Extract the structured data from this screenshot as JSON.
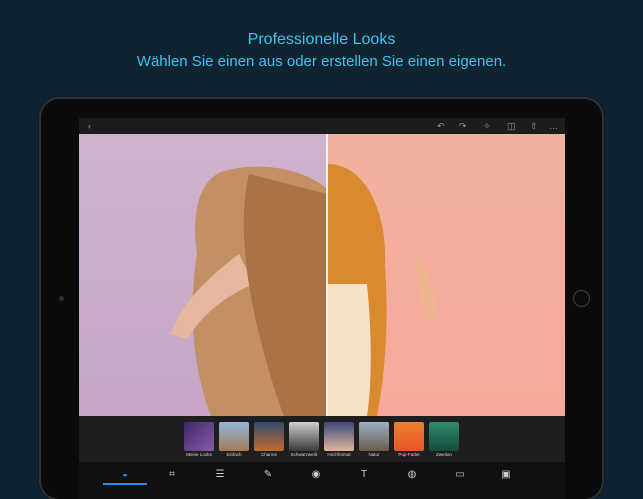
{
  "header": {
    "title": "Professionelle Looks",
    "subtitle": "Wählen Sie einen aus oder erstellen Sie einen eigenen."
  },
  "topbar": {
    "back_icon": "chevron-left-icon",
    "undo_icon": "undo-icon",
    "redo_icon": "redo-icon",
    "auto_fix_icon": "magic-wand-icon",
    "compare_icon": "compare-icon",
    "share_icon": "share-icon",
    "more_icon": "more-icon"
  },
  "looks": [
    {
      "label": "Meine Looks",
      "color": "#5b3b7a"
    },
    {
      "label": "Einfach",
      "color": "#7aa3c9"
    },
    {
      "label": "Charme",
      "color": "#c36a2e"
    },
    {
      "label": "Schwarzweiß",
      "color": "#8a8a8a"
    },
    {
      "label": "Hochformat",
      "color": "#c8a090"
    },
    {
      "label": "Natur",
      "color": "#7c8fa0"
    },
    {
      "label": "Pop-Farbe",
      "color": "#f07f2b"
    },
    {
      "label": "Zweiton",
      "color": "#2f8c6e"
    }
  ],
  "tools": [
    {
      "name": "looks-tool",
      "icon": "looks-icon",
      "glyph": "◒",
      "active": true
    },
    {
      "name": "crop-tool",
      "icon": "crop-icon",
      "glyph": "⌗"
    },
    {
      "name": "adjust-tool",
      "icon": "sliders-icon",
      "glyph": "☰"
    },
    {
      "name": "heal-tool",
      "icon": "bandage-icon",
      "glyph": "✎"
    },
    {
      "name": "red-eye-tool",
      "icon": "eye-icon",
      "glyph": "◉"
    },
    {
      "name": "text-tool",
      "icon": "text-icon",
      "glyph": "T"
    },
    {
      "name": "sticker-tool",
      "icon": "sticker-icon",
      "glyph": "◍"
    },
    {
      "name": "frame-tool",
      "icon": "frame-icon",
      "glyph": "▭"
    },
    {
      "name": "overlay-tool",
      "icon": "overlay-icon",
      "glyph": "▣"
    }
  ],
  "colors": {
    "accent": "#3ec3ef",
    "tool_active": "#2d8ce9",
    "background": "#0f2430"
  }
}
